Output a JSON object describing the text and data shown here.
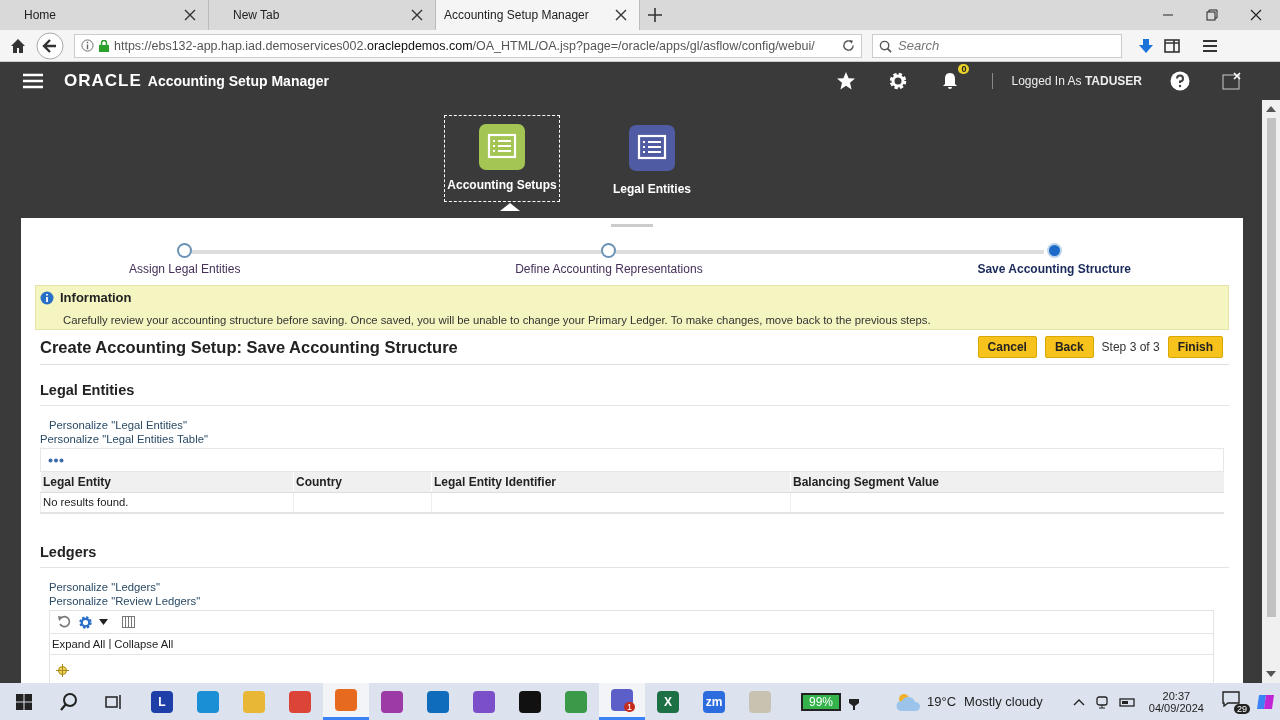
{
  "browser": {
    "tabs": [
      {
        "title": "Home",
        "selected": false
      },
      {
        "title": "New Tab",
        "selected": false
      },
      {
        "title": "Accounting Setup Manager",
        "selected": true
      }
    ],
    "url": {
      "prefix": "https://ebs132-app.hap.iad.demoservices002.",
      "domain": "oraclepdemos.com",
      "path": "/OA_HTML/OA.jsp?page=/oracle/apps/gl/asflow/config/webui/"
    },
    "search": {
      "placeholder": "Search"
    }
  },
  "header": {
    "logo": "ORACLE",
    "title": "Accounting Setup Manager",
    "notifications": "0",
    "user": "Logged In As **TADUSER**"
  },
  "springboard": [
    {
      "label": "Accounting Setups",
      "color": "#a4c553",
      "selected": true
    },
    {
      "label": "Legal Entities",
      "color": "#4f5ca3",
      "selected": false
    }
  ],
  "train": [
    {
      "label": "Assign Legal Entities",
      "selected": false
    },
    {
      "label": "Define Accounting Representations",
      "selected": false
    },
    {
      "label": "Save Accounting Structure",
      "selected": true
    }
  ],
  "info": {
    "title": "Information",
    "message": "Carefully review your accounting structure before saving. Once saved, you will be unable to change your Primary Ledger. To make changes, move back to the previous steps."
  },
  "page": {
    "title": "Create Accounting Setup: Save Accounting Structure",
    "actions": [
      {
        "kind": "button",
        "label": "Cancel"
      },
      {
        "kind": "button",
        "label": "Back"
      },
      {
        "kind": "text",
        "label": "Step 3 of 3"
      },
      {
        "kind": "button",
        "label": "Finish"
      }
    ]
  },
  "legal_entities": {
    "title": "Legal Entities",
    "links": [
      "Personalize \"Legal Entities\"",
      "Personalize \"Legal Entities Table\""
    ],
    "columns": [
      "Legal Entity",
      "Country",
      "Legal Entity Identifier",
      "Balancing Segment Value"
    ],
    "empty": "No results found."
  },
  "ledgers": {
    "title": "Ledgers",
    "links": [
      "Personalize \"Ledgers\"",
      "Personalize \"Review Ledgers\""
    ],
    "expand": "Expand All",
    "separator": "|",
    "collapse": "Collapse All"
  },
  "taskbar": {
    "apps": [
      {
        "kind": "app",
        "color": "#1f3fa8",
        "label": "L",
        "active": false
      },
      {
        "kind": "app",
        "color": "#1b8fd6",
        "active": false
      },
      {
        "kind": "app",
        "color": "#e8b735",
        "active": false
      },
      {
        "kind": "app",
        "color": "#db4437",
        "active": false
      },
      {
        "kind": "app",
        "color": "#e66b1f",
        "active": true
      },
      {
        "kind": "app",
        "color": "#9c3ba6",
        "active": false
      },
      {
        "kind": "app",
        "color": "#0f6cbd",
        "active": false
      },
      {
        "kind": "app",
        "color": "#7b4fc9",
        "active": false
      },
      {
        "kind": "app",
        "color": "#111111",
        "active": false
      },
      {
        "kind": "app",
        "color": "#3a9a4a",
        "active": false
      },
      {
        "kind": "app",
        "color": "#5b5fc7",
        "active": true,
        "badge": "1"
      },
      {
        "kind": "app",
        "color": "#1d7044",
        "label": "X",
        "active": false
      },
      {
        "kind": "app",
        "color": "#2d6cdf",
        "label": "zm",
        "active": false
      },
      {
        "kind": "app",
        "color": "#c9c2b0",
        "active": false
      }
    ],
    "battery": "99%",
    "temperature": "19°C",
    "weather": "Mostly cloudy",
    "time": "20:37",
    "date": "04/09/2024",
    "notifications": "29"
  }
}
